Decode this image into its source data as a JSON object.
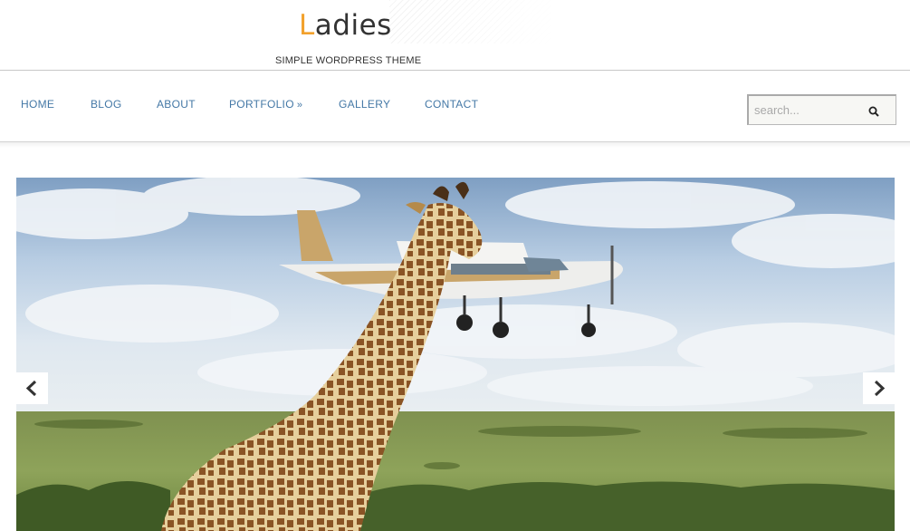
{
  "site": {
    "logo_first_letter": "L",
    "logo_rest": "adies",
    "tagline": "SIMPLE WORDPRESS THEME",
    "accent_color": "#f2a12c",
    "nav_color": "#4478a6"
  },
  "nav": {
    "home": "HOME",
    "blog": "BLOG",
    "about": "ABOUT",
    "portfolio": "PORTFOLIO",
    "portfolio_chevron": "»",
    "gallery": "GALLERY",
    "contact": "CONTACT"
  },
  "search": {
    "placeholder": "search...",
    "icon": "search-icon"
  },
  "slider": {
    "image_subject": "giraffe-and-airplane-photo",
    "prev_icon": "chevron-left-icon",
    "next_icon": "chevron-right-icon"
  }
}
